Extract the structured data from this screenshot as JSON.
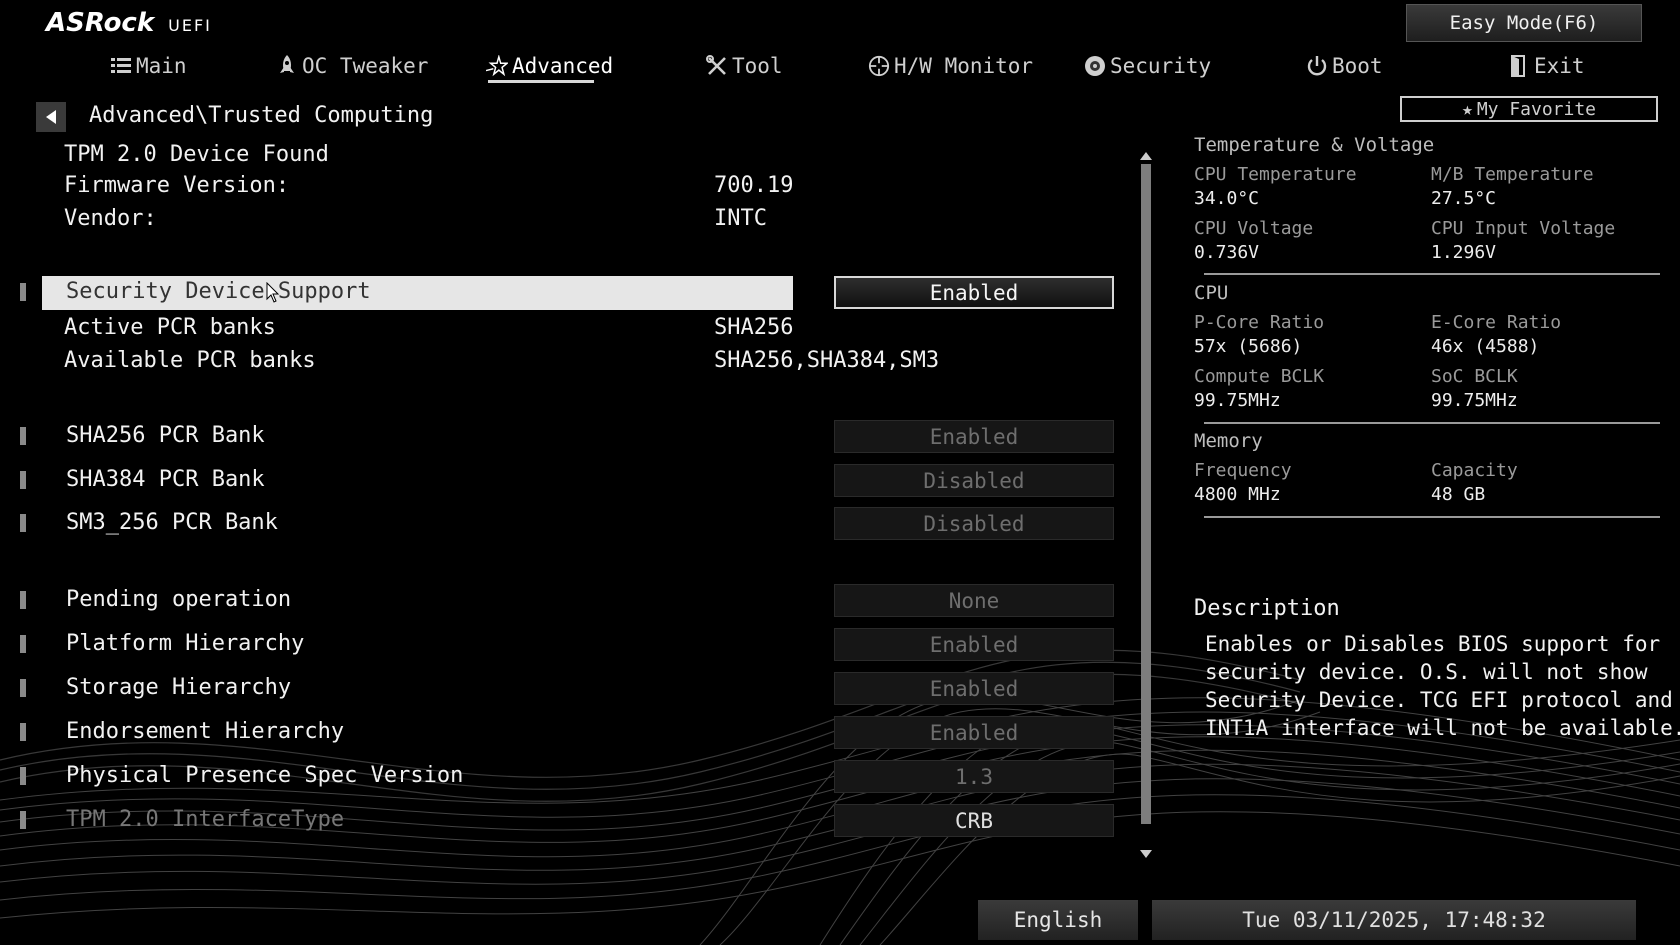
{
  "header": {
    "brand": "ASRock",
    "brand_sub": "UEFI",
    "easy_mode_label": "Easy Mode(F6)",
    "favorite_label": "My Favorite"
  },
  "nav": {
    "tabs": [
      {
        "label": "Main",
        "icon": "list-icon"
      },
      {
        "label": "OC Tweaker",
        "icon": "rocket-icon"
      },
      {
        "label": "Advanced",
        "icon": "star-icon",
        "active": true
      },
      {
        "label": "Tool",
        "icon": "wrench-icon"
      },
      {
        "label": "H/W Monitor",
        "icon": "crosshair-icon"
      },
      {
        "label": "Security",
        "icon": "shield-icon"
      },
      {
        "label": "Boot",
        "icon": "power-icon"
      },
      {
        "label": "Exit",
        "icon": "exit-icon"
      }
    ]
  },
  "breadcrumb": "Advanced\\Trusted Computing",
  "info": {
    "device_found": "TPM 2.0 Device Found",
    "firmware_label": "Firmware Version:",
    "firmware_value": "700.19",
    "vendor_label": "Vendor:",
    "vendor_value": "INTC"
  },
  "settings": {
    "security_device_support": {
      "label": "Security Device Support",
      "value": "Enabled"
    },
    "active_pcr": {
      "label": "Active PCR banks",
      "value": "SHA256"
    },
    "available_pcr": {
      "label": "Available PCR banks",
      "value": "SHA256,SHA384,SM3"
    },
    "sha256_bank": {
      "label": "SHA256 PCR Bank",
      "value": "Enabled"
    },
    "sha384_bank": {
      "label": "SHA384 PCR Bank",
      "value": "Disabled"
    },
    "sm3_bank": {
      "label": "SM3_256 PCR Bank",
      "value": "Disabled"
    },
    "pending_op": {
      "label": "Pending operation",
      "value": "None"
    },
    "platform_hierarchy": {
      "label": "Platform Hierarchy",
      "value": "Enabled"
    },
    "storage_hierarchy": {
      "label": "Storage Hierarchy",
      "value": "Enabled"
    },
    "endorsement_hierarchy": {
      "label": "Endorsement Hierarchy",
      "value": "Enabled"
    },
    "pp_spec_version": {
      "label": "Physical Presence Spec Version",
      "value": "1.3"
    },
    "tpm_interface": {
      "label": "TPM 2.0 InterfaceType",
      "value": "CRB"
    }
  },
  "hw": {
    "temp_volt_heading": "Temperature & Voltage",
    "cpu_temp_label": "CPU Temperature",
    "cpu_temp": "34.0°C",
    "mb_temp_label": "M/B Temperature",
    "mb_temp": "27.5°C",
    "cpu_volt_label": "CPU Voltage",
    "cpu_volt": "0.736V",
    "cpu_in_volt_label": "CPU Input Voltage",
    "cpu_in_volt": "1.296V",
    "cpu_heading": "CPU",
    "pcore_label": "P-Core Ratio",
    "pcore": "57x (5686)",
    "ecore_label": "E-Core Ratio",
    "ecore": "46x (4588)",
    "compute_bclk_label": "Compute BCLK",
    "compute_bclk": "99.75MHz",
    "soc_bclk_label": "SoC BCLK",
    "soc_bclk": "99.75MHz",
    "memory_heading": "Memory",
    "freq_label": "Frequency",
    "freq": "4800 MHz",
    "capacity_label": "Capacity",
    "capacity": "48 GB"
  },
  "description": {
    "title": "Description",
    "lines": [
      "Enables or Disables BIOS support for",
      "security device. O.S. will not show",
      "Security Device. TCG EFI protocol and",
      "INT1A interface will not be available."
    ]
  },
  "footer": {
    "language": "English",
    "datetime": "Tue 03/11/2025, 17:48:32"
  }
}
